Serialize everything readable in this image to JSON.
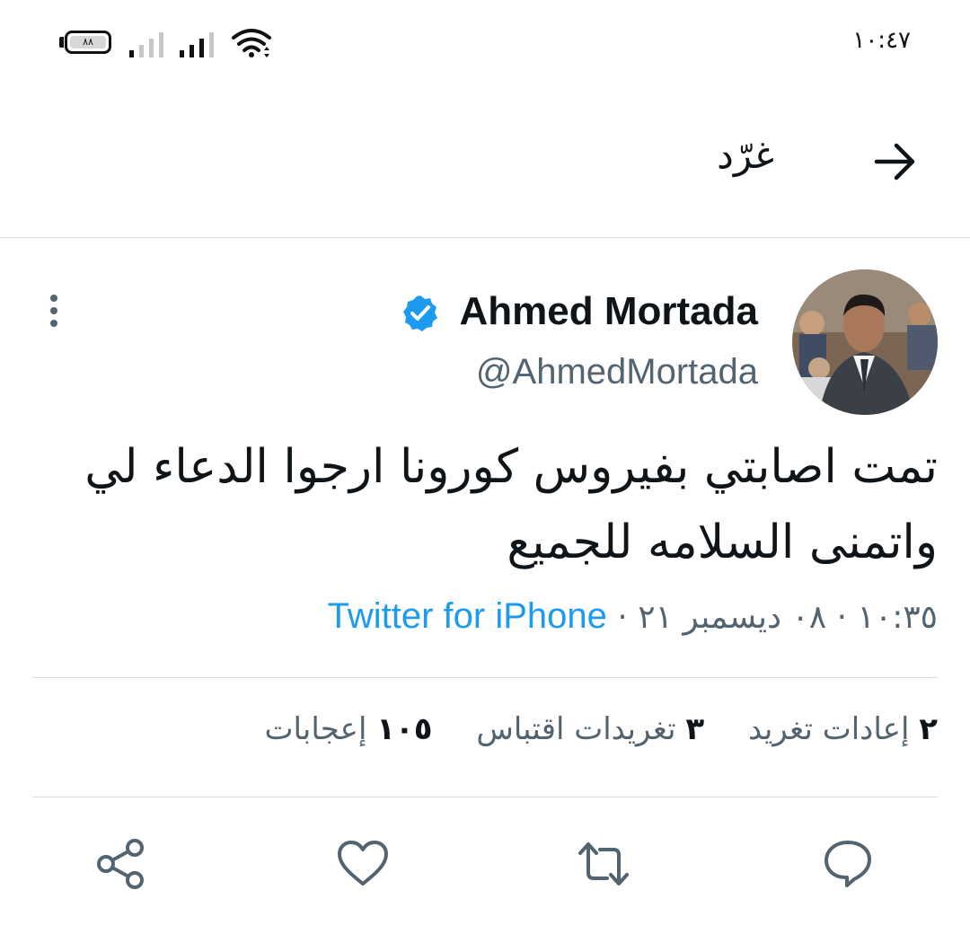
{
  "status_bar": {
    "time": "١٠:٤٧",
    "battery_label": "٨٨"
  },
  "header": {
    "title": "غرّد",
    "back_icon": "arrow-right-icon"
  },
  "tweet": {
    "display_name": "Ahmed Mortada",
    "handle": "@AhmedMortada",
    "verified": true,
    "text": "تمت اصابتي بفيروس كورونا ارجوا الدعاء لي واتمنى السلامه للجميع",
    "time": "١٠:٣٥",
    "date": "٠٨ ديسمبر ٢١",
    "separator": " · ",
    "source": "Twitter for iPhone"
  },
  "stats": {
    "retweets_count": "٢",
    "retweets_label": "إعادات تغريد",
    "quotes_count": "٣",
    "quotes_label": "تغريدات اقتباس",
    "likes_count": "١٠٥",
    "likes_label": "إعجابات"
  },
  "actions": {
    "icons": [
      "reply-icon",
      "retweet-icon",
      "like-icon",
      "share-icon"
    ]
  },
  "colors": {
    "accent": "#1d9bf0",
    "text": "#0f1419",
    "secondary": "#536471",
    "divider": "#d9dde0"
  }
}
